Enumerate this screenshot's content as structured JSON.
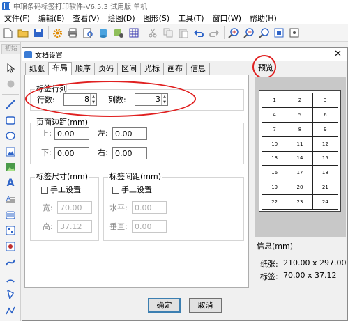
{
  "app": {
    "title": "中琅条码标签打印软件-V6.5.3 试用版 单机"
  },
  "menu": [
    "文件(F)",
    "编辑(E)",
    "查看(V)",
    "绘图(D)",
    "图形(S)",
    "工具(T)",
    "窗口(W)",
    "帮助(H)"
  ],
  "toolbar": {
    "icons": [
      "new-icon",
      "open-icon",
      "save-icon",
      "settings-icon",
      "print-icon",
      "print-preview-icon",
      "database-icon",
      "database-settings-icon",
      "grid-icon",
      "cut-icon",
      "copy-icon",
      "paste-icon",
      "undo-icon",
      "redo-icon",
      "zoom-in-icon",
      "zoom-out-icon",
      "zoom-fit-icon",
      "zoom-page-icon",
      "zoom-100-icon"
    ]
  },
  "left_tab_stub": "初始",
  "dialog": {
    "title": "文档设置",
    "close": "✕",
    "tabs": [
      "纸张",
      "布局",
      "顺序",
      "页码",
      "区间",
      "光标",
      "画布",
      "信息"
    ],
    "active_tab": "布局",
    "rows_cols": {
      "group_title": "标签行列",
      "rows_label": "行数:",
      "rows_value": "8",
      "cols_label": "列数:",
      "cols_value": "3"
    },
    "margins": {
      "group_title": "页面边距(mm)",
      "top_label": "上:",
      "top_value": "0.00",
      "left_label": "左:",
      "left_value": "0.00",
      "bottom_label": "下:",
      "bottom_value": "0.00",
      "right_label": "右:",
      "right_value": "0.00"
    },
    "label_size": {
      "group_title": "标签尺寸(mm)",
      "manual_label": "手工设置",
      "width_label": "宽:",
      "width_value": "70.00",
      "height_label": "高:",
      "height_value": "37.12"
    },
    "label_gap": {
      "group_title": "标签间距(mm)",
      "manual_label": "手工设置",
      "horizontal_label": "水平:",
      "horizontal_value": "0.00",
      "vertical_label": "垂直:",
      "vertical_value": "0.00"
    },
    "preview": {
      "label": "预览",
      "cells": [
        "1",
        "2",
        "3",
        "4",
        "5",
        "6",
        "7",
        "8",
        "9",
        "10",
        "11",
        "12",
        "13",
        "14",
        "15",
        "16",
        "17",
        "18",
        "19",
        "20",
        "21",
        "22",
        "23",
        "24"
      ]
    },
    "info": {
      "title": "信息(mm)",
      "paper_label": "纸张:",
      "paper_value": "210.00 x 297.00",
      "label_label": "标签:",
      "label_value": "70.00 x 37.12"
    },
    "ok_label": "确定",
    "cancel_label": "取消"
  },
  "colors": {
    "annotation_red": "#e02020",
    "default_button_border": "#3c7fb1"
  }
}
